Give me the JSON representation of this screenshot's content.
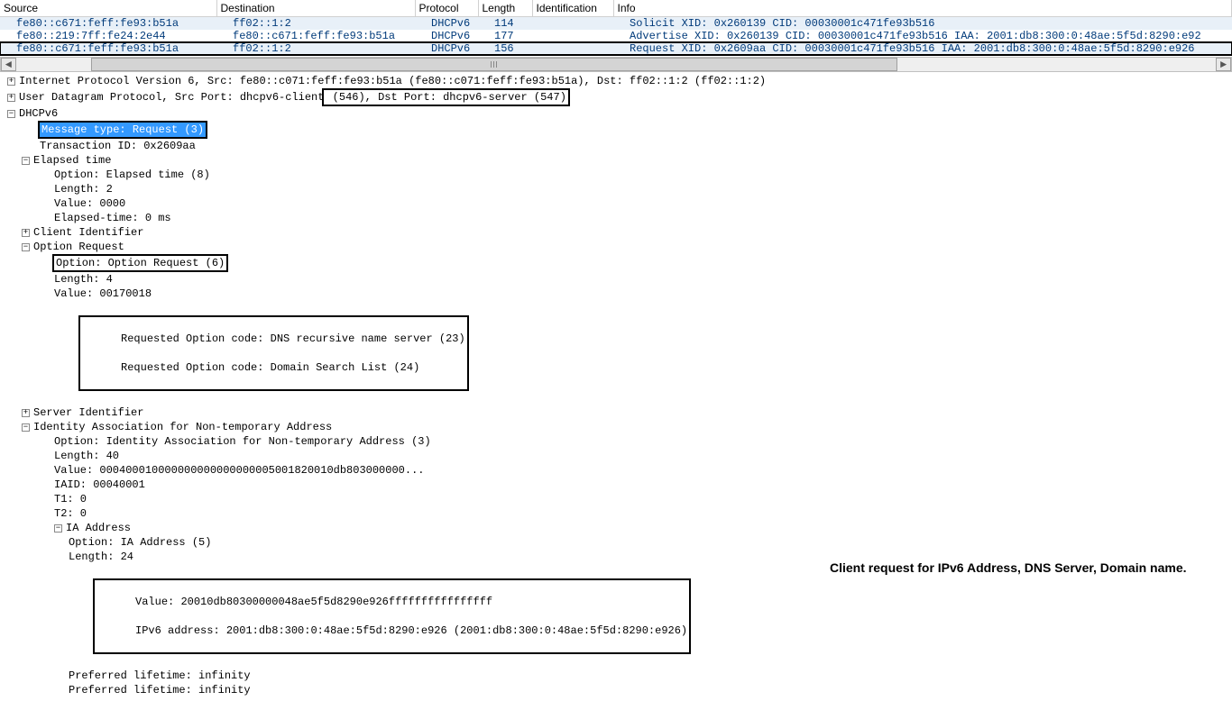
{
  "columns": [
    "Source",
    "Destination",
    "Protocol",
    "Length",
    "Identification",
    "Info"
  ],
  "packets": [
    {
      "src": "fe80::c671:feff:fe93:b51a",
      "dst": "ff02::1:2",
      "proto": "DHCPv6",
      "len": "114",
      "id": "",
      "info": "Solicit XID: 0x260139 CID: 00030001c471fe93b516",
      "hl": true,
      "boxed": false
    },
    {
      "src": "fe80::219:7ff:fe24:2e44",
      "dst": "fe80::c671:feff:fe93:b51a",
      "proto": "DHCPv6",
      "len": "177",
      "id": "",
      "info": "Advertise XID: 0x260139 CID: 00030001c471fe93b516 IAA: 2001:db8:300:0:48ae:5f5d:8290:e92",
      "hl": false,
      "boxed": false
    },
    {
      "src": "fe80::c671:feff:fe93:b51a",
      "dst": "ff02::1:2",
      "proto": "DHCPv6",
      "len": "156",
      "id": "",
      "info": "Request XID: 0x2609aa CID: 00030001c471fe93b516 IAA: 2001:db8:300:0:48ae:5f5d:8290:e926",
      "hl": true,
      "boxed": true
    }
  ],
  "ipline": "Internet Protocol Version 6, Src: fe80::c071:feff:fe93:b51a (fe80::c071:feff:fe93:b51a), Dst: ff02::1:2 (ff02::1:2)",
  "udp_prefix": "User Datagram Protocol, Src Port: dhcpv6-client",
  "udp_box": " (546), Dst Port: dhcpv6-server (547)",
  "dhcp": "DHCPv6",
  "msg_type": "Message type: Request (3)",
  "txid": "Transaction ID: 0x2609aa",
  "elapsed": "Elapsed time",
  "elapsed_opts": [
    "Option: Elapsed time (8)",
    "Length: 2",
    "Value: 0000",
    "Elapsed-time: 0 ms"
  ],
  "client_id": "Client Identifier",
  "opt_req": "Option Request",
  "opt_req_option": "Option: Option Request (6)",
  "opt_req_len": "Length: 4",
  "opt_req_val": "Value: 00170018",
  "opt_req_codes": [
    "Requested Option code: DNS recursive name server (23)",
    "Requested Option code: Domain Search List (24)"
  ],
  "server_id": "Server Identifier",
  "iana": "Identity Association for Non-temporary Address",
  "iana_opts": [
    "Option: Identity Association for Non-temporary Address (3)",
    "Length: 40",
    "Value: 000400010000000000000000005001820010db803000000...",
    "IAID: 00040001",
    "T1: 0",
    "T2: 0"
  ],
  "iaaddr": "IA Address",
  "iaaddr_top": [
    "Option: IA Address (5)",
    "Length: 24"
  ],
  "iaaddr_box": [
    "Value: 20010db80300000048ae5f5d8290e926ffffffffffffffff",
    "IPv6 address: 2001:db8:300:0:48ae:5f5d:8290:e926 (2001:db8:300:0:48ae:5f5d:8290:e926)"
  ],
  "iaaddr_tail": [
    "Preferred lifetime: infinity",
    "Preferred lifetime: infinity"
  ],
  "annotation": "Client request for IPv6 Address, DNS Server, Domain name."
}
